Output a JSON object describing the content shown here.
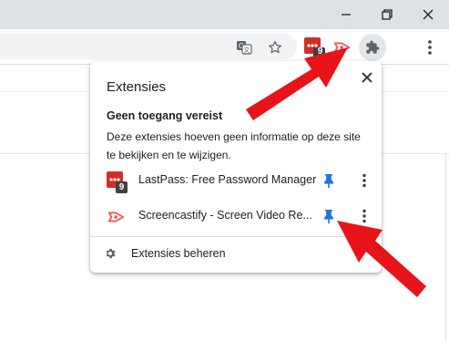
{
  "window": {
    "minimize_glyph": "—",
    "restore_icon": "restore-icon",
    "close_icon": "close-icon"
  },
  "toolbar": {
    "icons": [
      "translate-icon",
      "star-icon",
      "lastpass-icon",
      "screencastify-icon",
      "puzzle-icon",
      "more-vert-icon"
    ],
    "lastpass_badge": "9"
  },
  "popup": {
    "title": "Extensies",
    "section_heading": "Geen toegang vereist",
    "section_description": "Deze extensies hoeven geen informatie op deze site te bekijken en te wijzigen.",
    "extensions": [
      {
        "name": "LastPass: Free Password Manager",
        "badge": "9",
        "pinned": true
      },
      {
        "name": "Screencastify - Screen Video Re...",
        "pinned": true
      }
    ],
    "manage_label": "Extensies beheren"
  },
  "colors": {
    "titlebar": "#dee1e6",
    "pin_blue": "#1a73e8",
    "arrow_red": "#e8141a",
    "lastpass_red": "#d32d27",
    "screencastify_red": "#ef5a5a"
  }
}
